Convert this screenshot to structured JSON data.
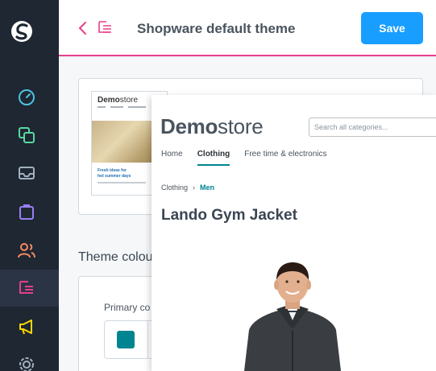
{
  "header": {
    "title": "Shopware default theme",
    "save_label": "Save"
  },
  "sidebar": {
    "items": [
      {
        "icon": "dashboard-icon",
        "color": "#4dc3e0"
      },
      {
        "icon": "products-icon",
        "color": "#57d9a3"
      },
      {
        "icon": "orders-icon",
        "color": "#a3b0c0"
      },
      {
        "icon": "customers-icon",
        "color": "#9a7ff5"
      },
      {
        "icon": "users-icon",
        "color": "#f88962"
      },
      {
        "icon": "content-icon",
        "color": "#e83e8c",
        "active": true
      },
      {
        "icon": "marketing-icon",
        "color": "#ffd700"
      },
      {
        "icon": "settings-icon",
        "color": "#a3b0c0"
      }
    ]
  },
  "content": {
    "colours_section_title": "Theme colou",
    "primary_colour_label": "Primary co",
    "primary_colour_value": "#008490",
    "mini_preview": {
      "logo_bold": "Demo",
      "logo_rest": "store",
      "caption_line1": "Fresh ideas for",
      "caption_line2": "hot summer days"
    }
  },
  "storefront": {
    "logo_bold": "Demo",
    "logo_rest": "store",
    "search_placeholder": "Search all categories...",
    "nav": [
      "Home",
      "Clothing",
      "Free time & electronics"
    ],
    "nav_active_index": 1,
    "breadcrumb": [
      "Clothing",
      "Men"
    ],
    "product_title": "Lando Gym Jacket"
  },
  "colors": {
    "accent": "#189eff",
    "brand_pink": "#e83e8c",
    "storefront_primary": "#008490",
    "sidebar_bg": "#1e2732"
  }
}
